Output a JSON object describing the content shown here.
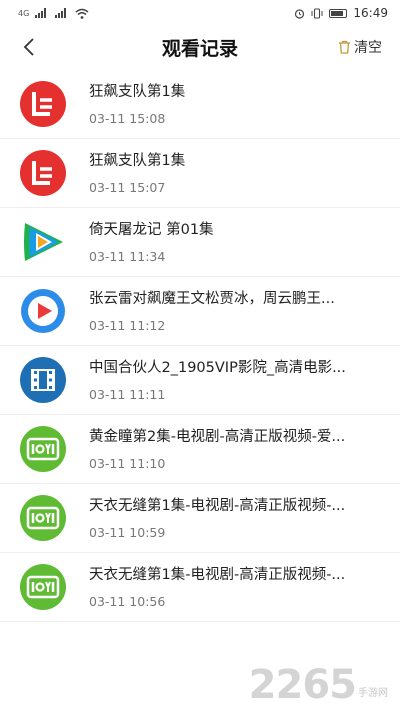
{
  "status_bar": {
    "signal_label": "4G",
    "time": "16:49"
  },
  "header": {
    "title": "观看记录",
    "clear_label": "清空"
  },
  "history": [
    {
      "app": "letv",
      "title": "狂飙支队第1集",
      "time": "03-11 15:08"
    },
    {
      "app": "letv",
      "title": "狂飙支队第1集",
      "time": "03-11 15:07"
    },
    {
      "app": "tencent-video",
      "title": "倚天屠龙记 第01集",
      "time": "03-11 11:34"
    },
    {
      "app": "youku",
      "title": "张云雷对飙魔王文松贾冰，周云鹏王...",
      "time": "03-11 11:12"
    },
    {
      "app": "1905-film",
      "title": "中国合伙人2_1905VIP影院_高清电影...",
      "time": "03-11 11:11"
    },
    {
      "app": "iqiyi",
      "title": "黄金瞳第2集-电视剧-高清正版视频-爱...",
      "time": "03-11 11:10"
    },
    {
      "app": "iqiyi",
      "title": "天衣无缝第1集-电视剧-高清正版视频-...",
      "time": "03-11 10:59"
    },
    {
      "app": "iqiyi",
      "title": "天衣无缝第1集-电视剧-高清正版视频-...",
      "time": "03-11 10:56"
    }
  ],
  "watermark": {
    "big": "2265",
    "small": "手游网"
  },
  "colors": {
    "letv": "#e4312f",
    "tencent_green": "#20b24a",
    "tencent_blue": "#1a9de0",
    "youku_blue": "#2d8ce8",
    "youku_red": "#ea3b3b",
    "film1905": "#1f6fb5",
    "iqiyi": "#5fbb33"
  }
}
